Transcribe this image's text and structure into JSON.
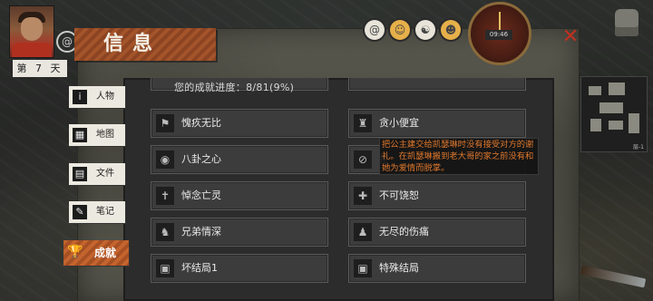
{
  "hud": {
    "day_label": "第 7 天",
    "clock_time": "09:46",
    "status_icons": [
      "ring-icon",
      "food-icon",
      "water-icon",
      "mood-icon"
    ],
    "close_icon": "close-x-icon",
    "minimap_label": "层-1"
  },
  "title": "信息",
  "tabs": [
    {
      "label": "人物",
      "icon": "i"
    },
    {
      "label": "地图",
      "icon": "▦"
    },
    {
      "label": "文件",
      "icon": "▤"
    },
    {
      "label": "笔记",
      "icon": "✎"
    },
    {
      "label": "成就",
      "icon": "🏆",
      "active": true
    }
  ],
  "progress": "您的成就进度：8/81(9%)",
  "achievements": {
    "left": [
      {
        "name": "愧疚无比",
        "icon": "⚑"
      },
      {
        "name": "八卦之心",
        "icon": "◉"
      },
      {
        "name": "悼念亡灵",
        "icon": "✝"
      },
      {
        "name": "兄弟情深",
        "icon": "♞"
      },
      {
        "name": "坏结局1",
        "icon": "▣"
      }
    ],
    "right": [
      {
        "name": "贪小便宜",
        "icon": "♜"
      },
      {
        "name": "拒",
        "icon": "⊘"
      },
      {
        "name": "不可饶恕",
        "icon": "✚"
      },
      {
        "name": "无尽的伤痛",
        "icon": "♟"
      },
      {
        "name": "特殊结局",
        "icon": "▣"
      }
    ]
  },
  "tooltip": "把公主建交给凯瑟琳时没有接受对方的谢礼。在凯瑟琳搬到老大哥的家之前没有和她为爱情而脱掌。"
}
